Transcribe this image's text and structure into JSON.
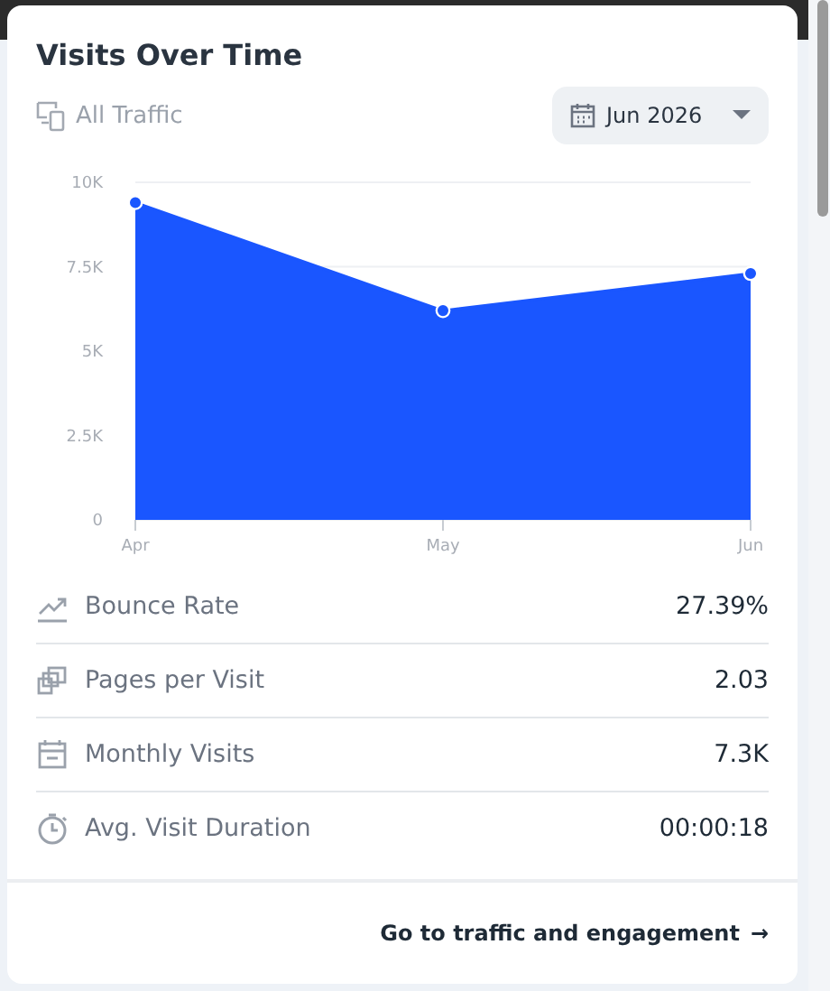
{
  "card": {
    "title": "Visits Over Time",
    "filter_label": "All Traffic",
    "date_picker": {
      "value": "Jun 2026"
    }
  },
  "chart": {
    "chart_data": {
      "type": "area",
      "categories": [
        "Apr",
        "May",
        "Jun"
      ],
      "values": [
        9400,
        6200,
        7300
      ],
      "ylim": [
        0,
        10000
      ],
      "yticks": [
        {
          "value": 0,
          "label": "0"
        },
        {
          "value": 2500,
          "label": "2.5K"
        },
        {
          "value": 5000,
          "label": "5K"
        },
        {
          "value": 7500,
          "label": "7.5K"
        },
        {
          "value": 10000,
          "label": "10K"
        }
      ]
    }
  },
  "metrics": [
    {
      "kind": "bounce",
      "label": "Bounce Rate",
      "value": "27.39%"
    },
    {
      "kind": "pages",
      "label": "Pages per Visit",
      "value": "2.03"
    },
    {
      "kind": "visits",
      "label": "Monthly Visits",
      "value": "7.3K"
    },
    {
      "kind": "duration",
      "label": "Avg. Visit Duration",
      "value": "00:00:18"
    }
  ],
  "footer": {
    "link": "Go to traffic and engagement",
    "link_icon": "→"
  }
}
